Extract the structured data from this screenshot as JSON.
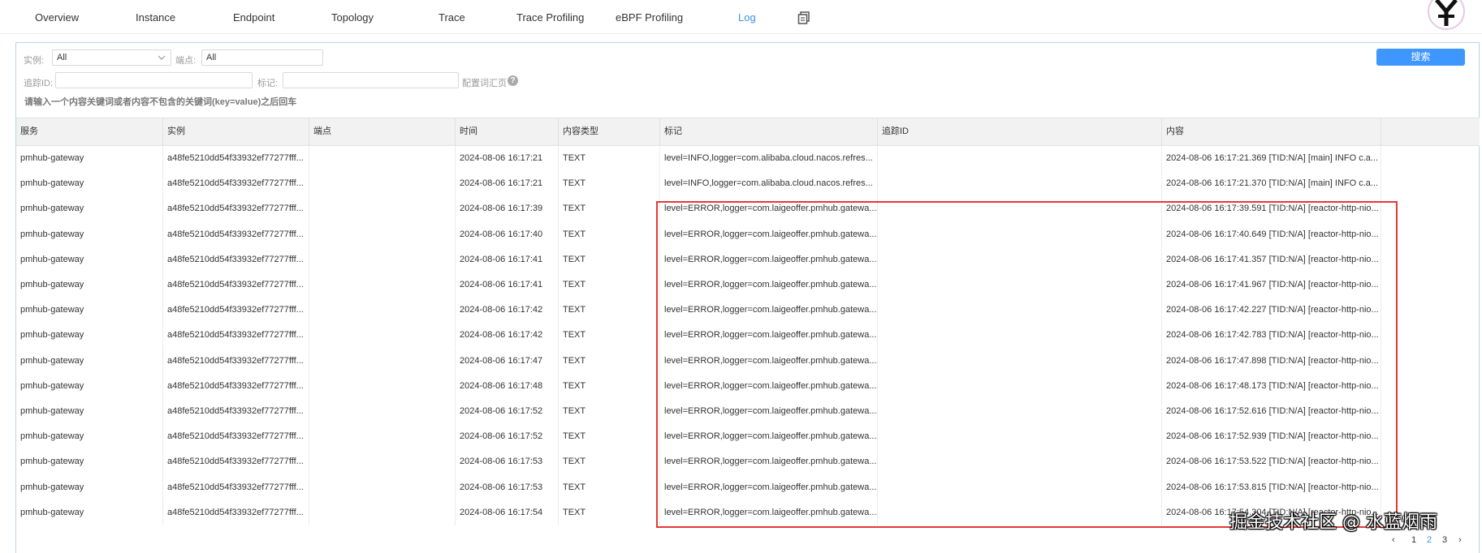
{
  "nav": {
    "tabs": [
      "Overview",
      "Instance",
      "Endpoint",
      "Topology",
      "Trace",
      "Trace Profiling",
      "eBPF Profiling",
      "Log"
    ],
    "active": "Log",
    "extra_icon": "document-copy-icon",
    "logo_icon": "app-logo-icon"
  },
  "filters": {
    "instance_label": "实例:",
    "instance_value": "All",
    "endpoint_label": "端点:",
    "endpoint_value": "All",
    "trace_id_label": "追踪ID:",
    "trace_id_value": "",
    "tags_label": "标记:",
    "tags_value": "",
    "config_link": "配置词汇页",
    "hint": "请输入一个内容关键词或者内容不包含的关键词(key=value)之后回车",
    "search_button": "搜索"
  },
  "table": {
    "headers": [
      "服务",
      "实例",
      "端点",
      "时间",
      "内容类型",
      "标记",
      "追踪ID",
      "内容"
    ],
    "rows": [
      [
        "pmhub-gateway",
        "a48fe5210dd54f33932ef77277fff...",
        "",
        "2024-08-06 16:17:21",
        "TEXT",
        "level=INFO,logger=com.alibaba.cloud.nacos.refres...",
        "",
        "2024-08-06 16:17:21.369 [TID:N/A] [main] INFO c.a..."
      ],
      [
        "pmhub-gateway",
        "a48fe5210dd54f33932ef77277fff...",
        "",
        "2024-08-06 16:17:21",
        "TEXT",
        "level=INFO,logger=com.alibaba.cloud.nacos.refres...",
        "",
        "2024-08-06 16:17:21.370 [TID:N/A] [main] INFO c.a..."
      ],
      [
        "pmhub-gateway",
        "a48fe5210dd54f33932ef77277fff...",
        "",
        "2024-08-06 16:17:39",
        "TEXT",
        "level=ERROR,logger=com.laigeoffer.pmhub.gatewa...",
        "",
        "2024-08-06 16:17:39.591 [TID:N/A] [reactor-http-nio..."
      ],
      [
        "pmhub-gateway",
        "a48fe5210dd54f33932ef77277fff...",
        "",
        "2024-08-06 16:17:40",
        "TEXT",
        "level=ERROR,logger=com.laigeoffer.pmhub.gatewa...",
        "",
        "2024-08-06 16:17:40.649 [TID:N/A] [reactor-http-nio..."
      ],
      [
        "pmhub-gateway",
        "a48fe5210dd54f33932ef77277fff...",
        "",
        "2024-08-06 16:17:41",
        "TEXT",
        "level=ERROR,logger=com.laigeoffer.pmhub.gatewa...",
        "",
        "2024-08-06 16:17:41.357 [TID:N/A] [reactor-http-nio..."
      ],
      [
        "pmhub-gateway",
        "a48fe5210dd54f33932ef77277fff...",
        "",
        "2024-08-06 16:17:41",
        "TEXT",
        "level=ERROR,logger=com.laigeoffer.pmhub.gatewa...",
        "",
        "2024-08-06 16:17:41.967 [TID:N/A] [reactor-http-nio..."
      ],
      [
        "pmhub-gateway",
        "a48fe5210dd54f33932ef77277fff...",
        "",
        "2024-08-06 16:17:42",
        "TEXT",
        "level=ERROR,logger=com.laigeoffer.pmhub.gatewa...",
        "",
        "2024-08-06 16:17:42.227 [TID:N/A] [reactor-http-nio..."
      ],
      [
        "pmhub-gateway",
        "a48fe5210dd54f33932ef77277fff...",
        "",
        "2024-08-06 16:17:42",
        "TEXT",
        "level=ERROR,logger=com.laigeoffer.pmhub.gatewa...",
        "",
        "2024-08-06 16:17:42.783 [TID:N/A] [reactor-http-nio..."
      ],
      [
        "pmhub-gateway",
        "a48fe5210dd54f33932ef77277fff...",
        "",
        "2024-08-06 16:17:47",
        "TEXT",
        "level=ERROR,logger=com.laigeoffer.pmhub.gatewa...",
        "",
        "2024-08-06 16:17:47.898 [TID:N/A] [reactor-http-nio..."
      ],
      [
        "pmhub-gateway",
        "a48fe5210dd54f33932ef77277fff...",
        "",
        "2024-08-06 16:17:48",
        "TEXT",
        "level=ERROR,logger=com.laigeoffer.pmhub.gatewa...",
        "",
        "2024-08-06 16:17:48.173 [TID:N/A] [reactor-http-nio..."
      ],
      [
        "pmhub-gateway",
        "a48fe5210dd54f33932ef77277fff...",
        "",
        "2024-08-06 16:17:52",
        "TEXT",
        "level=ERROR,logger=com.laigeoffer.pmhub.gatewa...",
        "",
        "2024-08-06 16:17:52.616 [TID:N/A] [reactor-http-nio..."
      ],
      [
        "pmhub-gateway",
        "a48fe5210dd54f33932ef77277fff...",
        "",
        "2024-08-06 16:17:52",
        "TEXT",
        "level=ERROR,logger=com.laigeoffer.pmhub.gatewa...",
        "",
        "2024-08-06 16:17:52.939 [TID:N/A] [reactor-http-nio..."
      ],
      [
        "pmhub-gateway",
        "a48fe5210dd54f33932ef77277fff...",
        "",
        "2024-08-06 16:17:53",
        "TEXT",
        "level=ERROR,logger=com.laigeoffer.pmhub.gatewa...",
        "",
        "2024-08-06 16:17:53.522 [TID:N/A] [reactor-http-nio..."
      ],
      [
        "pmhub-gateway",
        "a48fe5210dd54f33932ef77277fff...",
        "",
        "2024-08-06 16:17:53",
        "TEXT",
        "level=ERROR,logger=com.laigeoffer.pmhub.gatewa...",
        "",
        "2024-08-06 16:17:53.815 [TID:N/A] [reactor-http-nio..."
      ],
      [
        "pmhub-gateway",
        "a48fe5210dd54f33932ef77277fff...",
        "",
        "2024-08-06 16:17:54",
        "TEXT",
        "level=ERROR,logger=com.laigeoffer.pmhub.gatewa...",
        "",
        "2024-08-06 16:17:54.304 [TID:N/A] [reactor-http-nio..."
      ]
    ]
  },
  "pagination": {
    "prev": "‹",
    "pages": [
      "1",
      "2",
      "3"
    ],
    "current": "2",
    "next": "›"
  },
  "watermark": "掘金技术社区 @ 水蓝烟雨",
  "colors": {
    "accent": "#3d92ea",
    "button": "#3d97ff",
    "highlight": "#e53935"
  }
}
